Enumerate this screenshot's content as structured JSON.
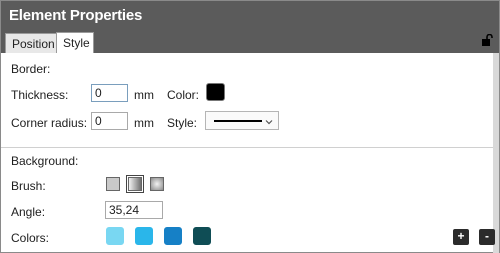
{
  "header": {
    "title": "Element Properties"
  },
  "tabs": [
    {
      "label": "Position"
    },
    {
      "label": "Style"
    }
  ],
  "border": {
    "section_label": "Border:",
    "thickness_label": "Thickness:",
    "thickness_value": "0",
    "thickness_unit": "mm",
    "color_label": "Color:",
    "color_value": "#000000",
    "corner_radius_label": "Corner radius:",
    "corner_radius_value": "0",
    "corner_radius_unit": "mm",
    "style_label": "Style:",
    "style_value": "solid"
  },
  "background": {
    "section_label": "Background:",
    "brush_label": "Brush:",
    "brush_options": [
      "solid",
      "linear-gradient",
      "radial-gradient"
    ],
    "brush_selected": "linear-gradient",
    "angle_label": "Angle:",
    "angle_value": "35,24",
    "colors_label": "Colors:",
    "colors": [
      "#79d7f2",
      "#2ab6ea",
      "#1680c6",
      "#0f4d55"
    ],
    "add_label": "+",
    "remove_label": "-"
  }
}
